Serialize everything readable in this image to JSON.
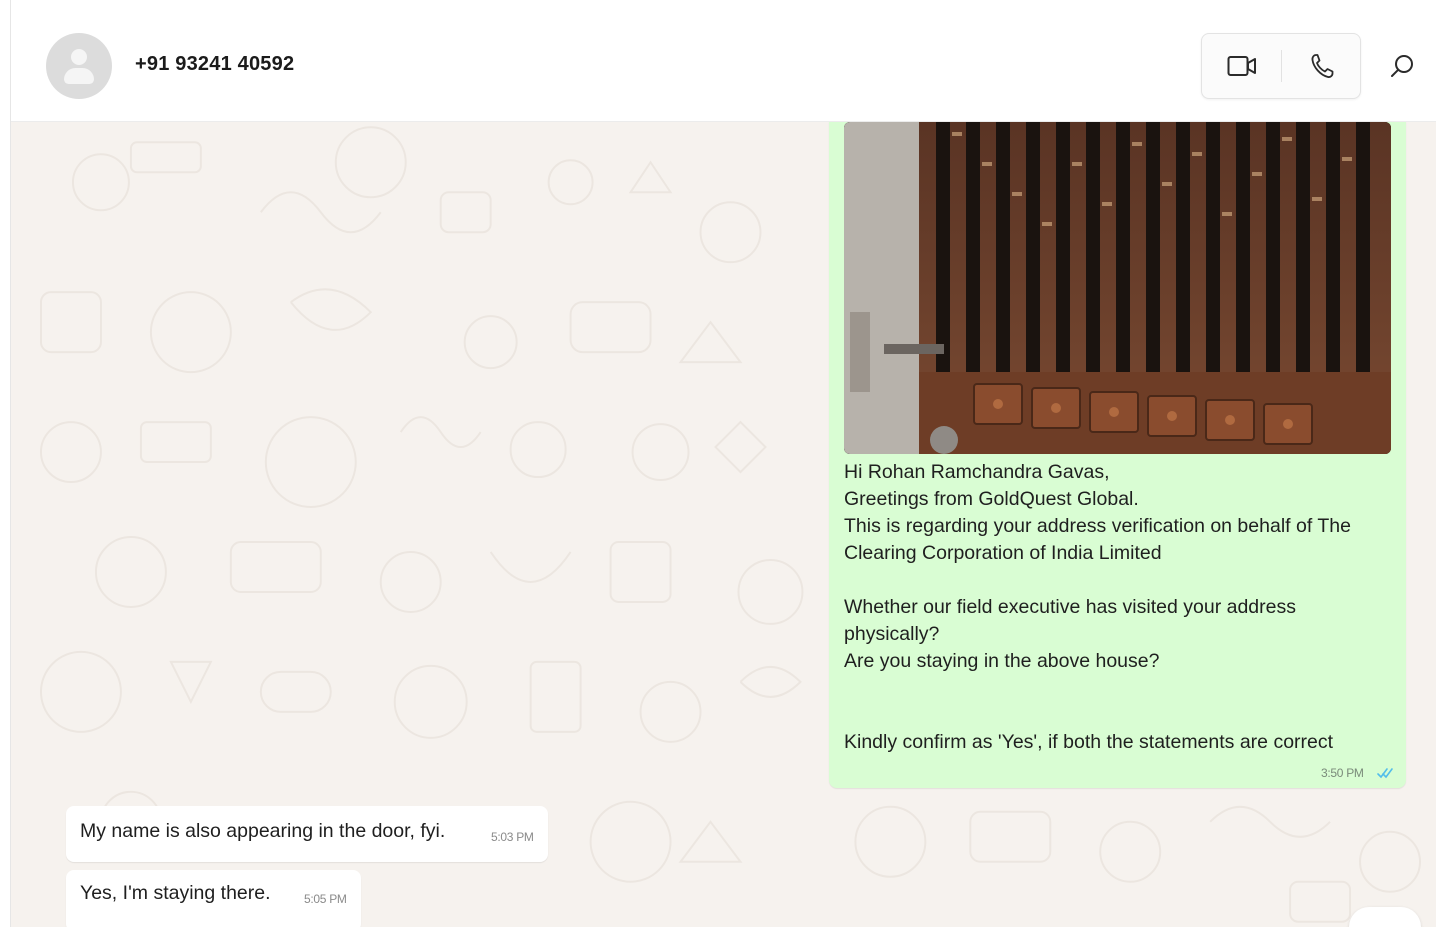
{
  "header": {
    "contact_name": "+91 93241 40592",
    "icons": {
      "avatar": "default-user-avatar",
      "video": "video-camera-icon",
      "voice": "phone-icon",
      "search": "search-icon"
    }
  },
  "messages": {
    "outgoing": {
      "image": "photo of wooden door with vertical bars",
      "lines": [
        "Hi Rohan Ramchandra Gavas,",
        "Greetings from GoldQuest Global.",
        "This is regarding your address verification on behalf of The Clearing Corporation of India Limited",
        "",
        "Whether our field executive has visited your address physically?",
        "Are you staying in the above house?",
        "",
        "",
        "Kindly confirm as 'Yes', if both the statements are correct"
      ],
      "time": "3:50 PM",
      "status_icon": "double-check-read-icon"
    },
    "incoming": [
      {
        "text": "My name is also appearing in the door, fyi.",
        "time": "5:03 PM"
      },
      {
        "text": "Yes, I'm staying there.",
        "time": "5:05 PM"
      }
    ]
  },
  "colors": {
    "outgoing_bubble": "#d9fdd3",
    "incoming_bubble": "#ffffff",
    "chat_background": "#f6f2ee",
    "read_ticks": "#53bdeb"
  }
}
